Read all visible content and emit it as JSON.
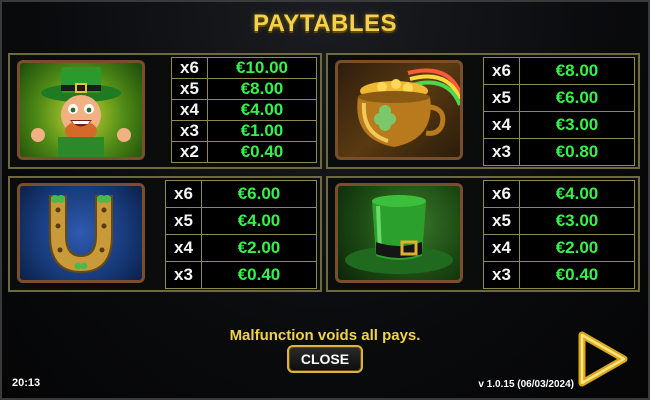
{
  "title": "PAYTABLES",
  "paytable": [
    {
      "symbol": "leprechaun-icon",
      "rows": [
        {
          "mult": "x6",
          "amount": "€10.00"
        },
        {
          "mult": "x5",
          "amount": "€8.00"
        },
        {
          "mult": "x4",
          "amount": "€4.00"
        },
        {
          "mult": "x3",
          "amount": "€1.00"
        },
        {
          "mult": "x2",
          "amount": "€0.40"
        }
      ]
    },
    {
      "symbol": "pot-of-gold-icon",
      "rows": [
        {
          "mult": "x6",
          "amount": "€8.00"
        },
        {
          "mult": "x5",
          "amount": "€6.00"
        },
        {
          "mult": "x4",
          "amount": "€3.00"
        },
        {
          "mult": "x3",
          "amount": "€0.80"
        }
      ]
    },
    {
      "symbol": "horseshoe-icon",
      "rows": [
        {
          "mult": "x6",
          "amount": "€6.00"
        },
        {
          "mult": "x5",
          "amount": "€4.00"
        },
        {
          "mult": "x4",
          "amount": "€2.00"
        },
        {
          "mult": "x3",
          "amount": "€0.40"
        }
      ]
    },
    {
      "symbol": "green-top-hat-icon",
      "rows": [
        {
          "mult": "x6",
          "amount": "€4.00"
        },
        {
          "mult": "x5",
          "amount": "€3.00"
        },
        {
          "mult": "x4",
          "amount": "€2.00"
        },
        {
          "mult": "x3",
          "amount": "€0.40"
        }
      ]
    }
  ],
  "notice": "Malfunction voids all pays.",
  "close_label": "CLOSE",
  "clock": "20:13",
  "version": "v 1.0.15 (06/03/2024)",
  "colors": {
    "title": "#f2d24a",
    "amount": "#35f24b",
    "border": "#8e8a52"
  }
}
